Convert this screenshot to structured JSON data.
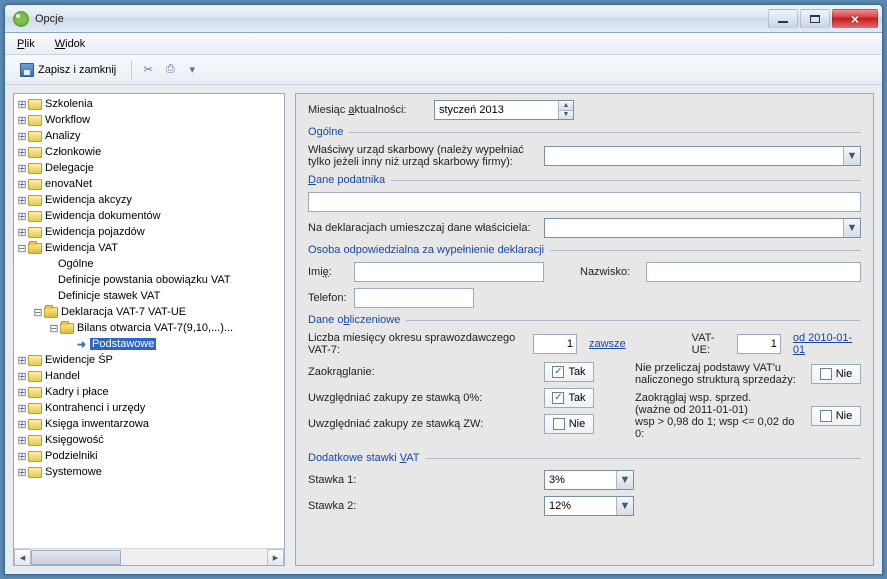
{
  "window": {
    "title": "Opcje"
  },
  "menu": {
    "plik": "Plik",
    "widok": "Widok"
  },
  "toolbar": {
    "save_close": "Zapisz i zamknij"
  },
  "tree": {
    "items": [
      {
        "depth": 0,
        "exp": "plus",
        "icon": "folder",
        "label": "Szkolenia"
      },
      {
        "depth": 0,
        "exp": "plus",
        "icon": "folder",
        "label": "Workflow"
      },
      {
        "depth": 0,
        "exp": "plus",
        "icon": "folder",
        "label": "Analizy"
      },
      {
        "depth": 0,
        "exp": "plus",
        "icon": "folder",
        "label": "Członkowie"
      },
      {
        "depth": 0,
        "exp": "plus",
        "icon": "folder",
        "label": "Delegacje"
      },
      {
        "depth": 0,
        "exp": "plus",
        "icon": "folder",
        "label": "enovaNet"
      },
      {
        "depth": 0,
        "exp": "plus",
        "icon": "folder",
        "label": "Ewidencja akcyzy"
      },
      {
        "depth": 0,
        "exp": "plus",
        "icon": "folder",
        "label": "Ewidencja dokumentów"
      },
      {
        "depth": 0,
        "exp": "plus",
        "icon": "folder",
        "label": "Ewidencja pojazdów"
      },
      {
        "depth": 0,
        "exp": "minus",
        "icon": "folder-open",
        "label": "Ewidencja VAT"
      },
      {
        "depth": 1,
        "exp": "",
        "icon": "",
        "label": "Ogólne"
      },
      {
        "depth": 1,
        "exp": "",
        "icon": "",
        "label": "Definicje powstania obowiązku VAT"
      },
      {
        "depth": 1,
        "exp": "",
        "icon": "",
        "label": "Definicje stawek VAT"
      },
      {
        "depth": 1,
        "exp": "minus",
        "icon": "folder-open",
        "label": "Deklaracja VAT-7 VAT-UE"
      },
      {
        "depth": 2,
        "exp": "minus",
        "icon": "folder-open",
        "label": "Bilans otwarcia VAT-7(9,10,...)..."
      },
      {
        "depth": 3,
        "exp": "",
        "icon": "special",
        "label": "Podstawowe",
        "selected": true
      },
      {
        "depth": 0,
        "exp": "plus",
        "icon": "folder",
        "label": "Ewidencje ŚP"
      },
      {
        "depth": 0,
        "exp": "plus",
        "icon": "folder",
        "label": "Handel"
      },
      {
        "depth": 0,
        "exp": "plus",
        "icon": "folder",
        "label": "Kadry i płace"
      },
      {
        "depth": 0,
        "exp": "plus",
        "icon": "folder",
        "label": "Kontrahenci i urzędy"
      },
      {
        "depth": 0,
        "exp": "plus",
        "icon": "folder",
        "label": "Księga inwentarzowa"
      },
      {
        "depth": 0,
        "exp": "plus",
        "icon": "folder",
        "label": "Księgowość"
      },
      {
        "depth": 0,
        "exp": "plus",
        "icon": "folder",
        "label": "Podzielniki"
      },
      {
        "depth": 0,
        "exp": "plus",
        "icon": "folder",
        "label": "Systemowe"
      }
    ]
  },
  "form": {
    "miesiac_aktualnosci_label": "Miesiąc aktualności:",
    "miesiac_aktualnosci_value": "styczeń 2013",
    "grp_ogolne": "Ogólne",
    "us_label": "Właściwy urząd skarbowy (należy wypełniać tylko jeżeli inny niż urząd skarbowy firmy):",
    "us_value": "",
    "grp_dane_podatnika": "Dane podatnika",
    "dane_podatnika_value": "",
    "dekl_wlasc_label": "Na deklaracjach umieszczaj dane właściciela:",
    "dekl_wlasc_value": "",
    "grp_osoba": "Osoba odpowiedzialna za wypełnienie deklaracji",
    "imie_label": "Imię:",
    "imie_value": "",
    "nazwisko_label": "Nazwisko:",
    "nazwisko_value": "",
    "telefon_label": "Telefon:",
    "telefon_value": "",
    "grp_dane_obl": "Dane obliczeniowe",
    "lm_label": "Liczba miesięcy okresu sprawozdawczego VAT-7:",
    "lm_value": "1",
    "zawsze_link": "zawsze",
    "vatue_label": "VAT-UE:",
    "vatue_value": "1",
    "vatue_link": "od 2010-01-01",
    "zaokr_label": "Zaokrąglanie:",
    "zaokr_chk": {
      "checked": true,
      "text": "Tak"
    },
    "nieprzel_label": "Nie przeliczaj podstawy VAT'u naliczonego strukturą sprzedaży:",
    "nieprzel_chk": {
      "checked": false,
      "text": "Nie"
    },
    "uwz0_label": "Uwzględniać zakupy ze stawką 0%:",
    "uwz0_chk": {
      "checked": true,
      "text": "Tak"
    },
    "zaokr_wsp_label": "Zaokrąglaj wsp. sprzed.\n(ważne od 2011-01-01)\nwsp > 0,98 do 1; wsp <= 0,02 do 0:",
    "zaokr_wsp_chk": {
      "checked": false,
      "text": "Nie"
    },
    "uwzzw_label": "Uwzględniać zakupy ze stawką ZW:",
    "uwzzw_chk": {
      "checked": false,
      "text": "Nie"
    },
    "grp_dodatkowe": "Dodatkowe stawki VAT",
    "stawka1_label": "Stawka 1:",
    "stawka1_value": "3%",
    "stawka2_label": "Stawka 2:",
    "stawka2_value": "12%"
  }
}
